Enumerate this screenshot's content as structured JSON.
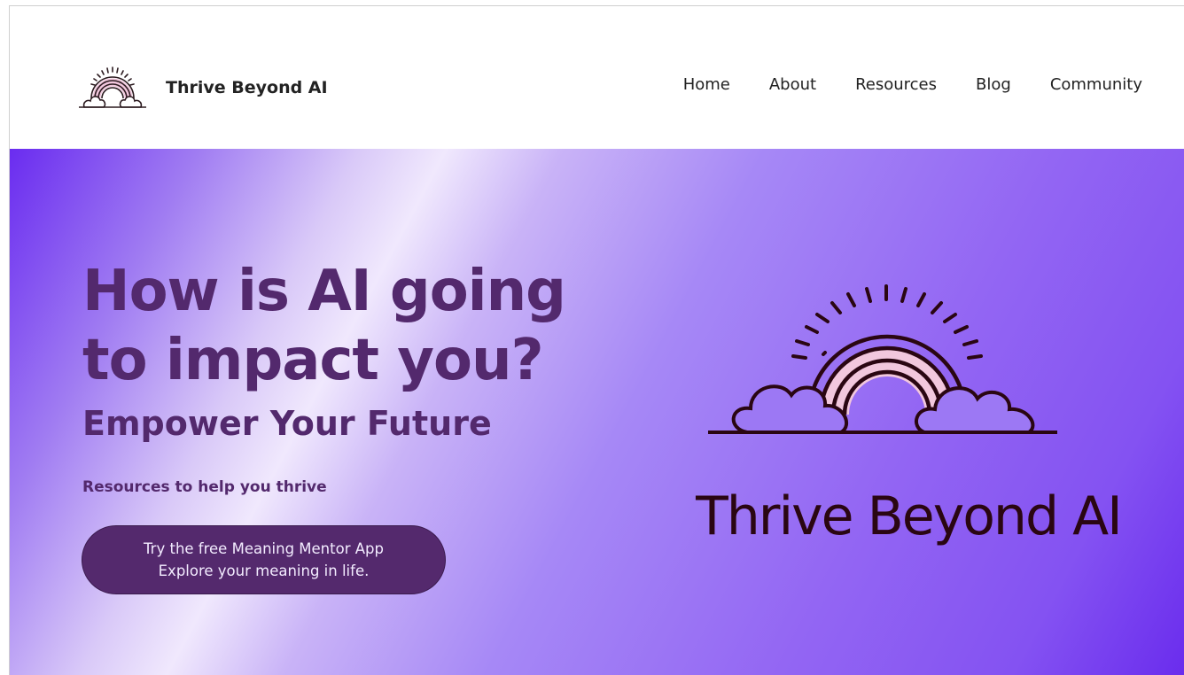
{
  "brand": {
    "name": "Thrive Beyond AI",
    "logo_icon": "rainbow-cloud-icon"
  },
  "nav": {
    "items": [
      {
        "label": "Home"
      },
      {
        "label": "About"
      },
      {
        "label": "Resources"
      },
      {
        "label": "Blog"
      },
      {
        "label": "Community"
      }
    ]
  },
  "hero": {
    "headline_line1": "How is AI going",
    "headline_line2": "to impact you?",
    "subheadline": "Empower Your Future",
    "tagline": "Resources to help you thrive",
    "cta_line1": "Try the free Meaning Mentor App",
    "cta_line2": "Explore your meaning in life.",
    "logo_title": "Thrive Beyond AI",
    "logo_icon": "rainbow-cloud-icon"
  },
  "colors": {
    "heading": "#53296d",
    "cta_background": "#54296d",
    "logo_text": "#2a0612",
    "rainbow_pink": "#f2c7dd"
  }
}
